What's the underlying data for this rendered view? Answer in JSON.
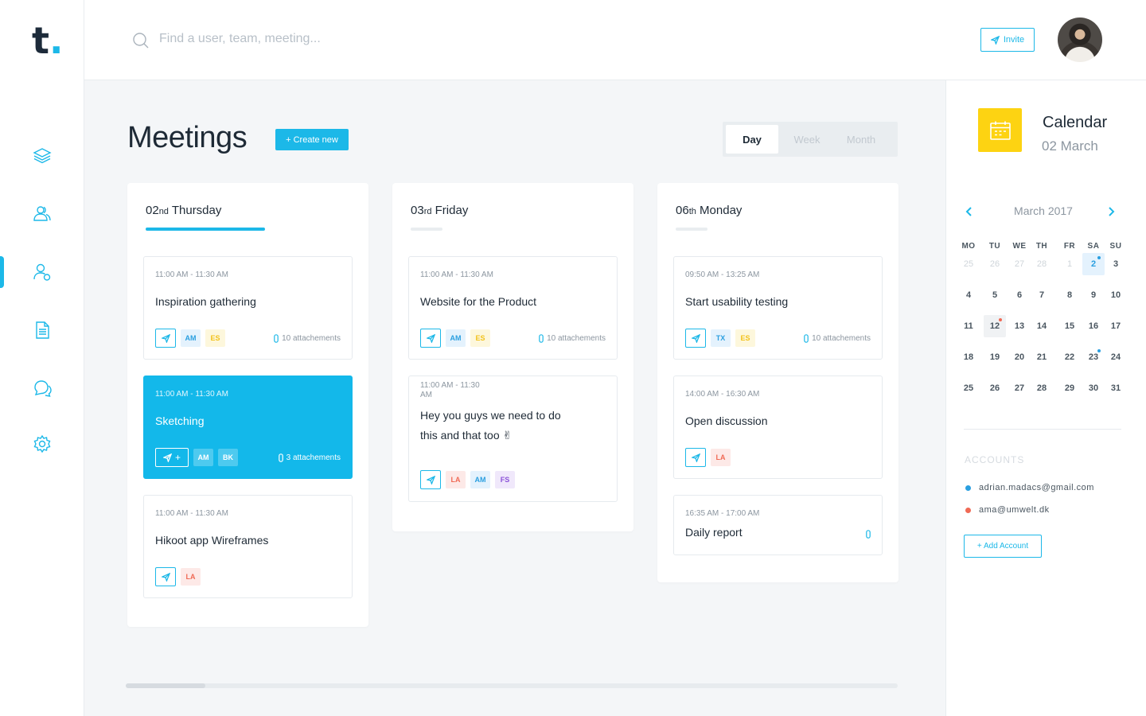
{
  "logo": {
    "letter": "t",
    "dot": "."
  },
  "search": {
    "placeholder": "Find a user, team, meeting..."
  },
  "header": {
    "invite_label": "Invite"
  },
  "page": {
    "title": "Meetings",
    "create_label": "+ Create new"
  },
  "view_switch": {
    "tabs": [
      "Day",
      "Week",
      "Month"
    ],
    "active": "Day"
  },
  "days": [
    {
      "num": "02",
      "suffix": "nd",
      "weekday": "Thursday",
      "active": true,
      "meetings": [
        {
          "time": "11:00 AM - 11:30 AM",
          "title": "Inspiration gathering",
          "tags": [
            "AM",
            "ES"
          ],
          "attachments": "10 attachements"
        },
        {
          "time": "11:00 AM - 11:30 AM",
          "title": "Sketching",
          "tags": [
            "AM",
            "BK"
          ],
          "attachments": "3 attachements",
          "active": true
        },
        {
          "time": "11:00 AM - 11:30 AM",
          "title": "Hikoot app Wireframes",
          "tags": [
            "LA"
          ]
        }
      ]
    },
    {
      "num": "03",
      "suffix": "rd",
      "weekday": "Friday",
      "meetings": [
        {
          "time": "11:00 AM - 11:30 AM",
          "title": "Website for the Product",
          "tags": [
            "AM",
            "ES"
          ],
          "attachments": "10 attachements"
        },
        {
          "time": "11:00 AM - 11:30\nAM",
          "title": "Hey you guys we need to do this and that too ✌",
          "tags": [
            "LA",
            "AM",
            "FS"
          ]
        }
      ]
    },
    {
      "num": "06",
      "suffix": "th",
      "weekday": "Monday",
      "meetings": [
        {
          "time": "09:50 AM - 13:25 AM",
          "title": "Start usability testing",
          "tags": [
            "TX",
            "ES"
          ],
          "attachments": "10 attachements"
        },
        {
          "time": "14:00 AM - 16:30 AM",
          "title": "Open discussion",
          "tags": [
            "LA"
          ]
        },
        {
          "time": "16:35 AM - 17:00 AM",
          "title": "Daily report",
          "tags": []
        }
      ]
    }
  ],
  "calendar": {
    "title": "Calendar",
    "date": "02 March",
    "month_label": "March 2017",
    "weekdays": [
      "MO",
      "TU",
      "WE",
      "TH",
      "FR",
      "SA",
      "SU"
    ],
    "weeks": [
      [
        "25",
        "26",
        "27",
        "28",
        "1",
        "2",
        "3"
      ],
      [
        "4",
        "5",
        "6",
        "7",
        "8",
        "9",
        "10"
      ],
      [
        "11",
        "12",
        "13",
        "14",
        "15",
        "16",
        "17"
      ],
      [
        "18",
        "19",
        "20",
        "21",
        "22",
        "23",
        "24"
      ],
      [
        "25",
        "26",
        "27",
        "28",
        "29",
        "30",
        "31"
      ]
    ],
    "selected": "2",
    "highlighted": "12"
  },
  "accounts": {
    "title": "ACCOUNTS",
    "items": [
      {
        "email": "adrian.madacs@gmail.com",
        "color": "#2a9fe0"
      },
      {
        "email": "ama@umwelt.dk",
        "color": "#f06a55"
      }
    ],
    "add_label": "+ Add Account"
  },
  "colors": {
    "accent": "#1cb8e8",
    "calendar_icon": "#fdd312"
  }
}
